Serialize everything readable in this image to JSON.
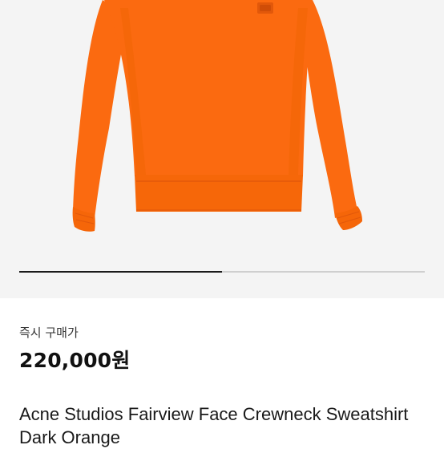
{
  "product": {
    "image_alt": "Orange crewneck sweatshirt",
    "color_hex": "#fb6a10",
    "shadow_hex": "#e2580a",
    "background_hex": "#f4f4f4",
    "gallery_progress": 0.5,
    "price_label": "즉시 구매가",
    "price": "220,000원",
    "title": "Acne Studios Fairview Face Crewneck Sweatshirt Dark Orange"
  }
}
